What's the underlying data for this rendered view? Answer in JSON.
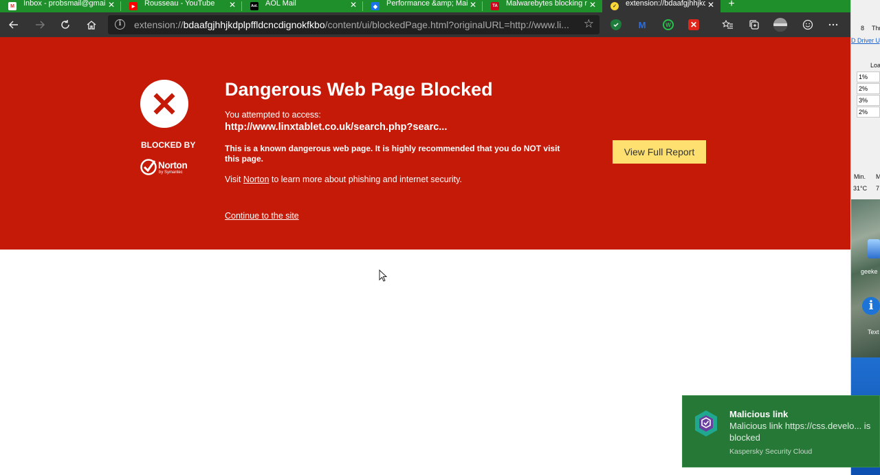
{
  "tabs": [
    {
      "title": "Inbox - probsmail@gmail",
      "icon": "gmail-icon",
      "color": "#d93025",
      "glyph": "M"
    },
    {
      "title": "Rousseau - YouTube",
      "icon": "youtube-icon",
      "color": "#ff0000",
      "glyph": "▶"
    },
    {
      "title": "AOL Mail",
      "icon": "aol-icon",
      "color": "#000000",
      "glyph": "Aol."
    },
    {
      "title": "Performance &amp; Main",
      "icon": "windows-icon",
      "color": "#1a73e8",
      "glyph": "◆"
    },
    {
      "title": "Malwarebytes blocking re",
      "icon": "tomsguide-icon",
      "color": "#d0021b",
      "glyph": "TA"
    },
    {
      "title": "extension://bdaafgjhhjkdp",
      "icon": "norton-icon",
      "color": "#fdd835",
      "glyph": "✓"
    }
  ],
  "tab_close_glyph": "✕",
  "new_tab_glyph": "+",
  "toolbar": {
    "url_prefix": "extension://",
    "url_host": "bdaafgjhhjkdplpffldcncdignokfkbo",
    "url_rest": "/content/ui/blockedPage.html?originalURL=http://www.li...",
    "info_glyph": "i",
    "star_glyph": "☆"
  },
  "block": {
    "headline": "Dangerous Web Page Blocked",
    "attempted": "You attempted to access:",
    "blocked_url": "http://www.linxtablet.co.uk/search.php?searc...",
    "warning": "This is a known dangerous web page. It is highly recommended that you do NOT visit this page.",
    "visit_prefix": "Visit ",
    "visit_link": "Norton",
    "visit_suffix": " to learn more about phishing and internet security.",
    "continue": "Continue to the site",
    "blocked_by": "BLOCKED BY",
    "brand": "Norton",
    "brand_sub": "by Symantec",
    "report_button": "View Full Report"
  },
  "desktop": {
    "top_a": "8",
    "top_b": "Thr",
    "link": "D Driver Up",
    "col_header": "Loa",
    "cells": [
      "1%",
      "2%",
      "3%",
      "2%"
    ],
    "min_label": "Min.",
    "min_extra": "M",
    "temp": "31°C",
    "temp_extra": "7",
    "icon_label_1": "geeke",
    "icon_label_2": "Text"
  },
  "toast": {
    "title": "Malicious link",
    "message": "Malicious link https://css.develo... is blocked",
    "app": "Kaspersky Security Cloud"
  },
  "colors": {
    "block_red": "#c61a09",
    "tab_green": "#1f8f2b",
    "report_yellow": "#fde070",
    "toast_green": "#267837"
  }
}
